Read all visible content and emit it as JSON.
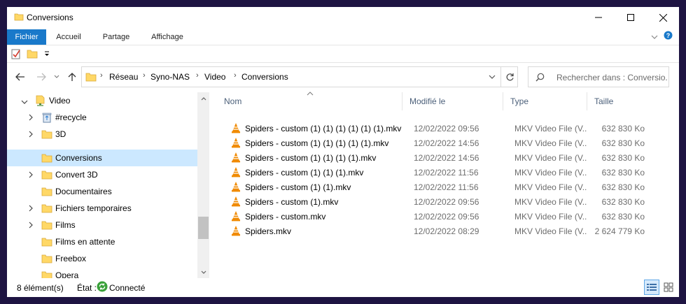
{
  "window": {
    "title": "Conversions"
  },
  "ribbon": {
    "tabs": [
      "Fichier",
      "Accueil",
      "Partage",
      "Affichage"
    ]
  },
  "address": {
    "crumbs": [
      "Réseau",
      "Syno-NAS",
      "Video",
      "Conversions"
    ]
  },
  "search": {
    "placeholder": "Rechercher dans : Conversio..."
  },
  "tree": {
    "items": [
      {
        "label": "Video",
        "icon": "network-folder-icon",
        "chevron": "expanded"
      },
      {
        "label": "#recycle",
        "icon": "recycle-bin-icon",
        "chevron": "collapsed"
      },
      {
        "label": "3D",
        "icon": "folder-icon",
        "chevron": "collapsed"
      },
      {
        "label": "Conversions",
        "icon": "folder-icon",
        "chevron": "none"
      },
      {
        "label": "Convert 3D",
        "icon": "folder-icon",
        "chevron": "collapsed"
      },
      {
        "label": "Documentaires",
        "icon": "folder-icon",
        "chevron": "none"
      },
      {
        "label": "Fichiers temporaires",
        "icon": "folder-icon",
        "chevron": "collapsed"
      },
      {
        "label": "Films",
        "icon": "folder-icon",
        "chevron": "collapsed"
      },
      {
        "label": "Films en attente",
        "icon": "folder-icon",
        "chevron": "none"
      },
      {
        "label": "Freebox",
        "icon": "folder-icon",
        "chevron": "none"
      },
      {
        "label": "Opera",
        "icon": "folder-icon",
        "chevron": "none"
      }
    ]
  },
  "list": {
    "columns": {
      "name": "Nom",
      "date": "Modifié le",
      "type": "Type",
      "size": "Taille"
    },
    "rows": [
      {
        "name": "Spiders - custom (1) (1) (1) (1) (1) (1).mkv",
        "date": "12/02/2022 09:56",
        "type": "MKV Video File (V...",
        "size": "632 830 Ko"
      },
      {
        "name": "Spiders - custom (1) (1) (1) (1) (1).mkv",
        "date": "12/02/2022 14:56",
        "type": "MKV Video File (V...",
        "size": "632 830 Ko"
      },
      {
        "name": "Spiders - custom (1) (1) (1) (1).mkv",
        "date": "12/02/2022 14:56",
        "type": "MKV Video File (V...",
        "size": "632 830 Ko"
      },
      {
        "name": "Spiders - custom (1) (1) (1).mkv",
        "date": "12/02/2022 11:56",
        "type": "MKV Video File (V...",
        "size": "632 830 Ko"
      },
      {
        "name": "Spiders - custom (1) (1).mkv",
        "date": "12/02/2022 11:56",
        "type": "MKV Video File (V...",
        "size": "632 830 Ko"
      },
      {
        "name": "Spiders - custom (1).mkv",
        "date": "12/02/2022 09:56",
        "type": "MKV Video File (V...",
        "size": "632 830 Ko"
      },
      {
        "name": "Spiders - custom.mkv",
        "date": "12/02/2022 09:56",
        "type": "MKV Video File (V...",
        "size": "632 830 Ko"
      },
      {
        "name": "Spiders.mkv",
        "date": "12/02/2022 08:29",
        "type": "MKV Video File (V...",
        "size": "2 624 779 Ko"
      }
    ]
  },
  "status": {
    "count": "8 élément(s)",
    "state_label": "État :",
    "state": "Connecté"
  },
  "colors": {
    "accent": "#1979ca",
    "selected": "#cce8ff",
    "folder": "#ffd867",
    "vlc": "#f08a00",
    "connected": "#3aa13a"
  }
}
